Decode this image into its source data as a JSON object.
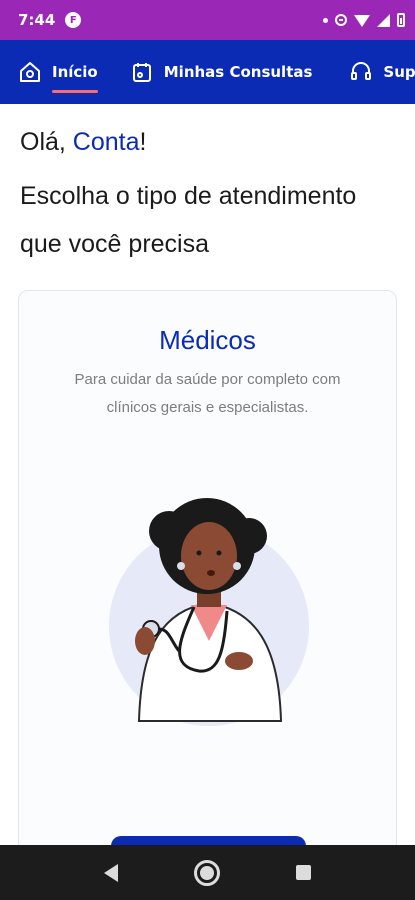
{
  "status_bar": {
    "time": "7:44",
    "app_icon_letter": "F"
  },
  "nav": {
    "items": [
      {
        "label": "Início",
        "icon": "home-icon",
        "active": true
      },
      {
        "label": "Minhas Consultas",
        "icon": "calendar-icon"
      },
      {
        "label": "Suporte",
        "icon": "headset-icon"
      }
    ],
    "active_indicator_color": "#ff6b6b"
  },
  "greeting": {
    "prefix": "Olá, ",
    "name": "Conta",
    "suffix": "!"
  },
  "subtitle": "Escolha o tipo de atendimento que você precisa",
  "card": {
    "title": "Médicos",
    "description": "Para cuidar da saúde por completo com clínicos gerais e especialistas."
  },
  "colors": {
    "primary": "#0c2bb5",
    "status_bar": "#9b27b6",
    "accent": "#ff6b6b"
  }
}
